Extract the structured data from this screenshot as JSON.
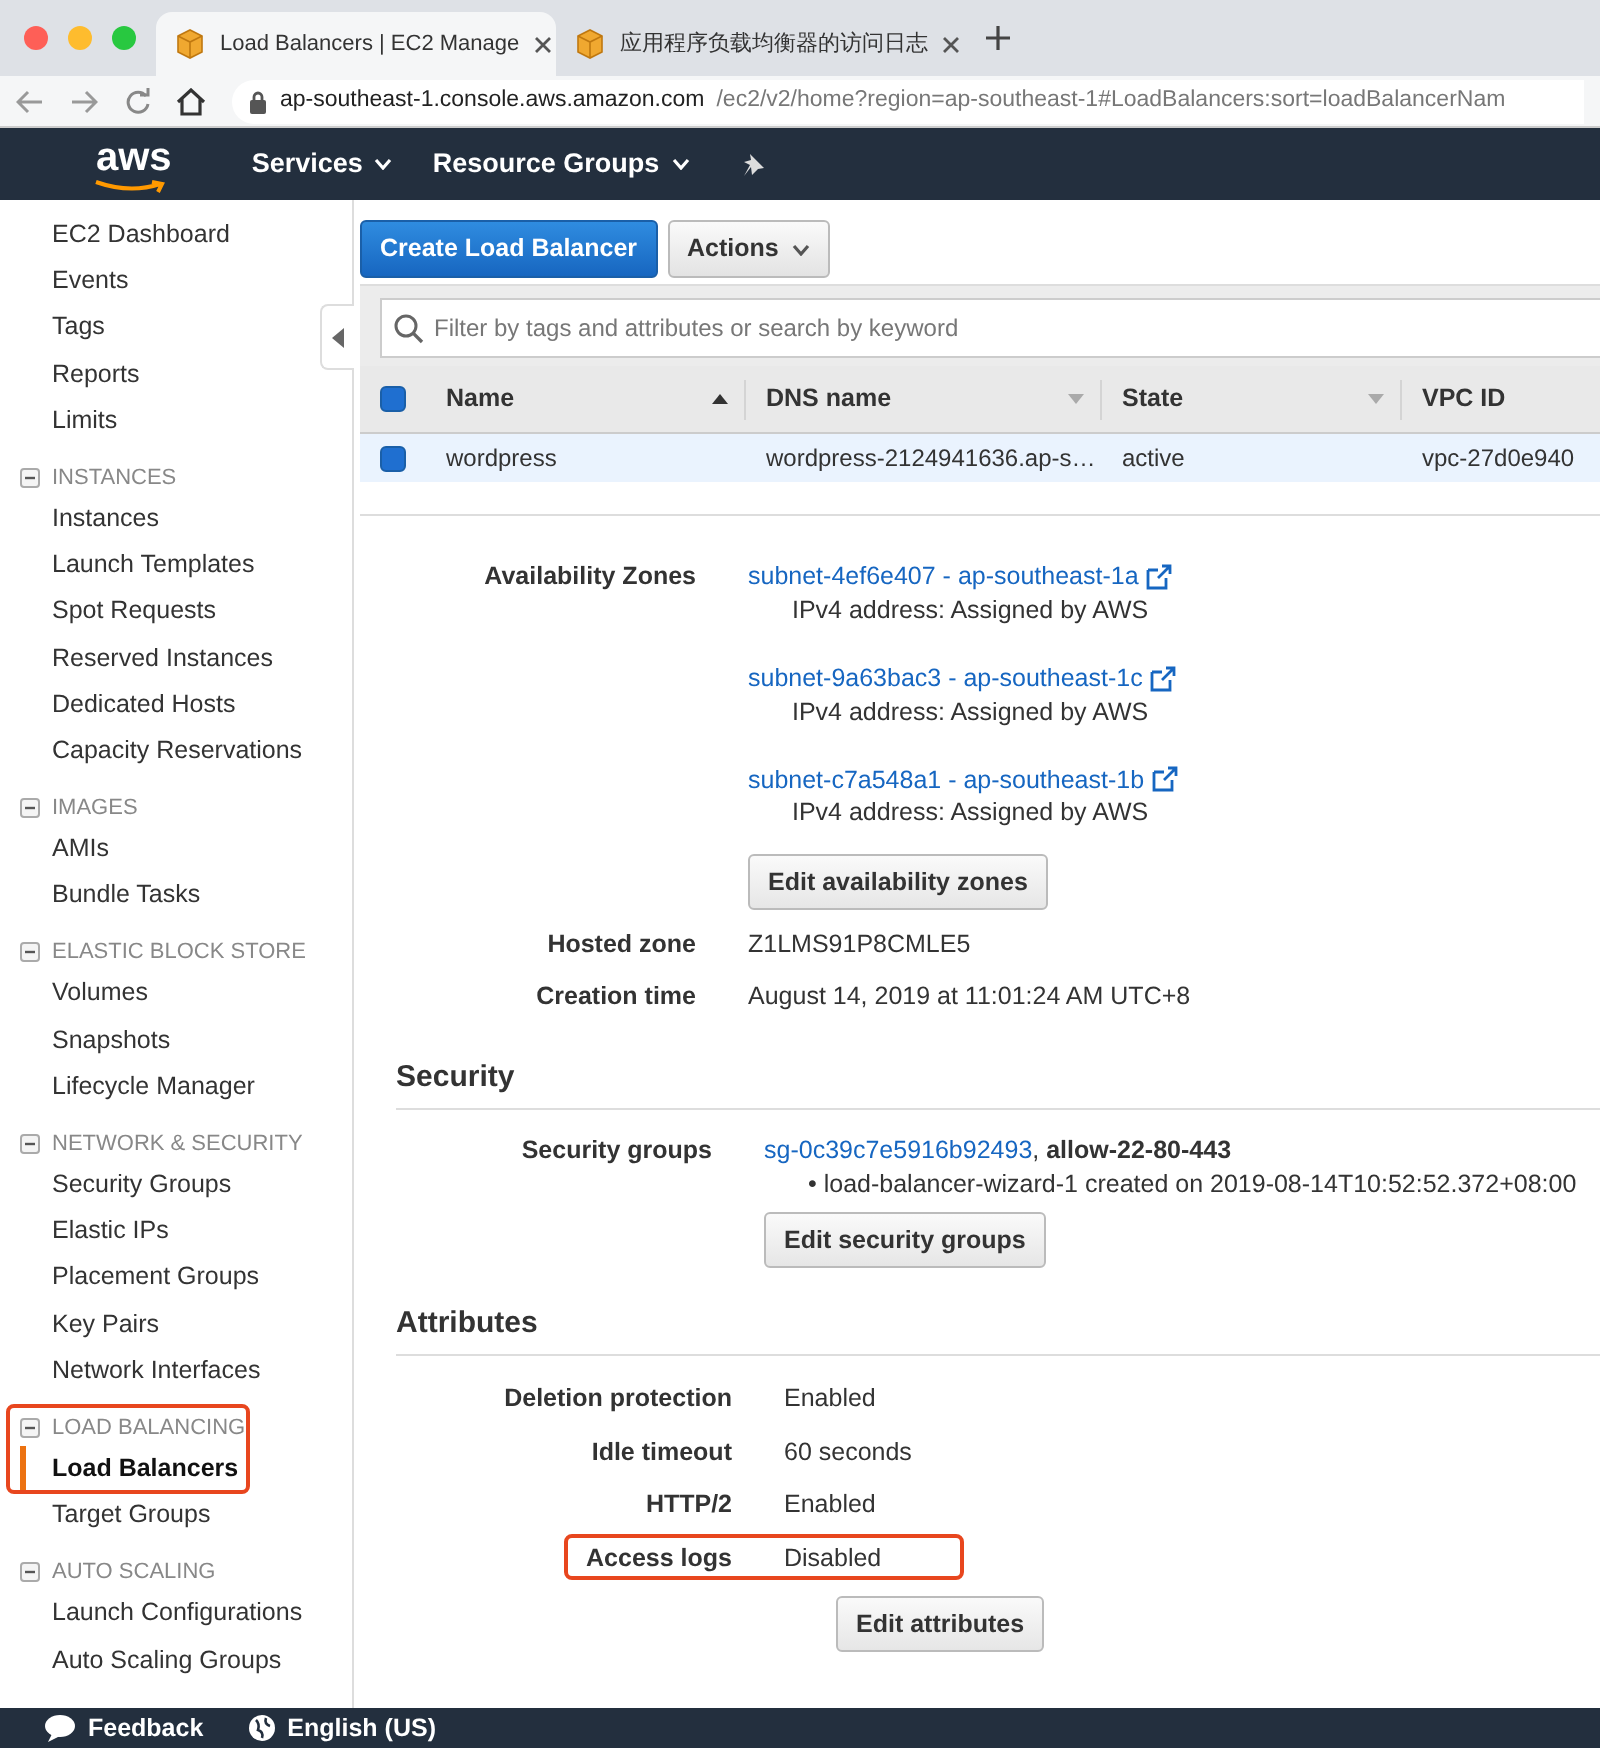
{
  "browser": {
    "tabs": [
      {
        "title": "Load Balancers | EC2 Manage",
        "selected": true
      },
      {
        "title": "应用程序负载均衡器的访问日志",
        "selected": false
      }
    ],
    "url": {
      "host": "ap-southeast-1.console.aws.amazon.com",
      "path": "/ec2/v2/home?region=ap-southeast-1#LoadBalancers:sort=loadBalancerNam"
    }
  },
  "navbar": {
    "logo": "aws",
    "menus": [
      "Services",
      "Resource Groups"
    ]
  },
  "sidebar": {
    "groups": [
      {
        "items": [
          {
            "label": "EC2 Dashboard",
            "selected": false
          },
          {
            "label": "Events",
            "selected": false
          },
          {
            "label": "Tags",
            "selected": false
          },
          {
            "label": "Reports",
            "selected": false
          },
          {
            "label": "Limits",
            "selected": false
          }
        ]
      },
      {
        "header": "INSTANCES",
        "expanded": true,
        "highlighted": false,
        "items": [
          {
            "label": "Instances",
            "selected": false
          },
          {
            "label": "Launch Templates",
            "selected": false
          },
          {
            "label": "Spot Requests",
            "selected": false
          },
          {
            "label": "Reserved Instances",
            "selected": false
          },
          {
            "label": "Dedicated Hosts",
            "selected": false
          },
          {
            "label": "Capacity Reservations",
            "selected": false
          }
        ]
      },
      {
        "header": "IMAGES",
        "expanded": true,
        "highlighted": false,
        "items": [
          {
            "label": "AMIs",
            "selected": false
          },
          {
            "label": "Bundle Tasks",
            "selected": false
          }
        ]
      },
      {
        "header": "ELASTIC BLOCK STORE",
        "expanded": true,
        "highlighted": false,
        "items": [
          {
            "label": "Volumes",
            "selected": false
          },
          {
            "label": "Snapshots",
            "selected": false
          },
          {
            "label": "Lifecycle Manager",
            "selected": false
          }
        ]
      },
      {
        "header": "NETWORK & SECURITY",
        "expanded": true,
        "highlighted": false,
        "items": [
          {
            "label": "Security Groups",
            "selected": false
          },
          {
            "label": "Elastic IPs",
            "selected": false
          },
          {
            "label": "Placement Groups",
            "selected": false
          },
          {
            "label": "Key Pairs",
            "selected": false
          },
          {
            "label": "Network Interfaces",
            "selected": false
          }
        ]
      },
      {
        "header": "LOAD BALANCING",
        "expanded": true,
        "highlighted": true,
        "items": [
          {
            "label": "Load Balancers",
            "selected": true
          },
          {
            "label": "Target Groups",
            "selected": false
          }
        ]
      },
      {
        "header": "AUTO SCALING",
        "expanded": true,
        "highlighted": false,
        "items": [
          {
            "label": "Launch Configurations",
            "selected": false
          },
          {
            "label": "Auto Scaling Groups",
            "selected": false
          }
        ]
      }
    ]
  },
  "toolbar": {
    "buttons": [
      {
        "label": "Create Load Balancer",
        "kind": "primary"
      },
      {
        "label": "Actions",
        "kind": "dropdown"
      }
    ]
  },
  "search": {
    "placeholder": "Filter by tags and attributes or search by keyword"
  },
  "table": {
    "header_checked": true,
    "columns": [
      {
        "label": "Name",
        "sorted": true
      },
      {
        "label": "DNS name",
        "sorted": false
      },
      {
        "label": "State",
        "sorted": false
      },
      {
        "label": "VPC ID"
      }
    ],
    "rows": [
      {
        "selected": true,
        "checked": true,
        "cells": [
          "wordpress",
          "wordpress-2124941636.ap-s…",
          "active",
          "vpc-27d0e940"
        ]
      }
    ]
  },
  "details": {
    "description": {
      "rows": [
        {
          "kind": "subnets",
          "label": "Availability Zones",
          "subnets": [
            {
              "link": "subnet-4ef6e407 - ap-southeast-1a",
              "note": "IPv4 address: Assigned by AWS"
            },
            {
              "link": "subnet-9a63bac3 - ap-southeast-1c",
              "note": "IPv4 address: Assigned by AWS"
            },
            {
              "link": "subnet-c7a548a1 - ap-southeast-1b",
              "note": "IPv4 address: Assigned by AWS"
            }
          ],
          "button": "Edit availability zones"
        },
        {
          "kind": "text",
          "label": "Hosted zone",
          "value": "Z1LMS91P8CMLE5"
        },
        {
          "kind": "text",
          "label": "Creation time",
          "value": "August 14, 2019 at 11:01:24 AM UTC+8"
        }
      ]
    },
    "security": {
      "title": "Security",
      "rows": [
        {
          "label": "Security groups",
          "link": "sg-0c39c7e5916b92493",
          "suffix": ", **allow-22-80-443**",
          "note": "• load-balancer-wizard-1 created on 2019-08-14T10:52:52.372+08:00"
        }
      ],
      "button": "Edit security groups"
    },
    "attributes": {
      "title": "Attributes",
      "rows": [
        {
          "label": "Deletion protection",
          "value": "Enabled",
          "highlighted": false
        },
        {
          "label": "Idle timeout",
          "value": "60 seconds",
          "highlighted": false
        },
        {
          "label": "HTTP/2",
          "value": "Enabled",
          "highlighted": false
        },
        {
          "label": "Access logs",
          "value": "Disabled",
          "highlighted": true
        }
      ],
      "button": "Edit attributes"
    }
  },
  "footer": {
    "links": [
      {
        "label": "Feedback"
      },
      {
        "label": "English (US)"
      }
    ]
  }
}
